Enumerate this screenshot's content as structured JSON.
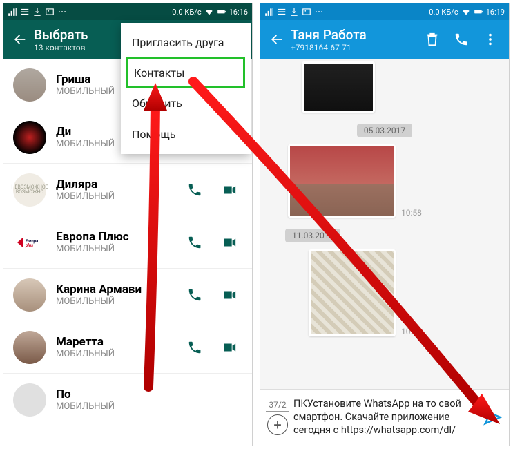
{
  "left": {
    "statusbar": {
      "net": "0.0 КБ/с",
      "time": "16:16"
    },
    "header": {
      "title": "Выбрать",
      "sub": "13 контактов"
    },
    "menu": {
      "invite": "Пригласить друга",
      "contacts": "Контакты",
      "update": "Обновить",
      "help": "Помощь"
    },
    "contacts": [
      {
        "name": "Гриша",
        "sub": "МОБИЛЬНЫЙ",
        "icons": false
      },
      {
        "name": "Ди",
        "sub": "МОБИЛЬНЫЙ",
        "icons": false
      },
      {
        "name": "Диляра",
        "sub": "МОБИЛЬНЫЙ",
        "icons": true
      },
      {
        "name": "Европа Плюс",
        "sub": "МОБИЛЬНЫЙ",
        "icons": true
      },
      {
        "name": "Карина Армави",
        "sub": "МОБИЛЬНЫЙ",
        "icons": true
      },
      {
        "name": "Маретта",
        "sub": "МОБИЛЬНЫЙ",
        "icons": true
      },
      {
        "name": "По",
        "sub": "МОБИЛЬНЫЙ",
        "icons": false
      }
    ]
  },
  "right": {
    "statusbar": {
      "net": "0.0 КБ/с",
      "time": "16:19"
    },
    "header": {
      "title": "Таня Работа",
      "sub": "+7918164-67-71"
    },
    "dates": {
      "d1": "05.03.2017",
      "d2": "11.03.2017"
    },
    "times": {
      "t1": "10:58",
      "t2": "10:38"
    },
    "composer": {
      "counter": "37/2",
      "text": "ПКУстановите WhatsApp на то свой смартфон. Скачайте приложение сегодня с https://whatsapp.com/dl/"
    }
  }
}
